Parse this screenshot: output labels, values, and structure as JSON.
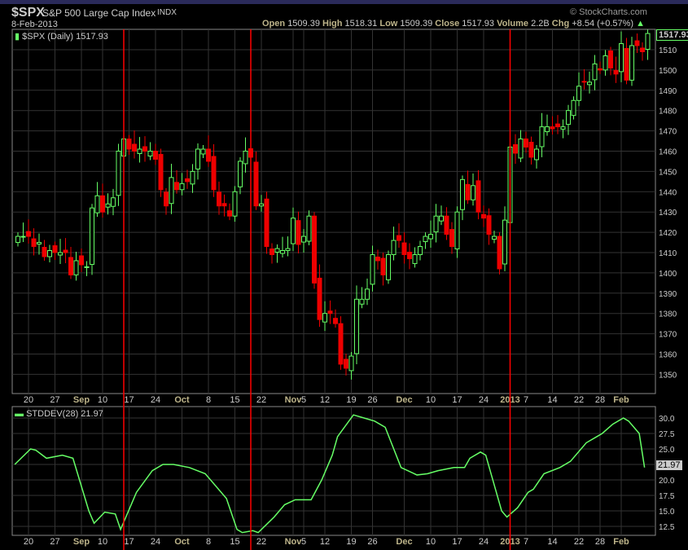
{
  "header": {
    "symbol": "$SPX",
    "name": "S&P 500 Large Cap Index",
    "exchange": "INDX",
    "date": "8-Feb-2013",
    "copyright": "© StockCharts.com",
    "open_label": "Open",
    "open": "1509.39",
    "high_label": "High",
    "high": "1518.31",
    "low_label": "Low",
    "low": "1509.39",
    "close_label": "Close",
    "close": "1517.93",
    "volume_label": "Volume",
    "volume": "2.2B",
    "chg_label": "Chg",
    "chg": "+8.54 (+0.57%)"
  },
  "colors": {
    "up": "#66ff66",
    "down": "#ee0000",
    "marker": "#ff0000",
    "grid": "#333333",
    "line": "#66ff66"
  },
  "chart_data": [
    {
      "type": "candlestick",
      "title": "$SPX (Daily) 1517.93",
      "last_value": "1517.93",
      "ylim": [
        1340,
        1520
      ],
      "yticks": [
        1350,
        1360,
        1370,
        1380,
        1390,
        1400,
        1410,
        1420,
        1430,
        1440,
        1450,
        1460,
        1470,
        1480,
        1490,
        1500,
        1510
      ],
      "close": [
        1418,
        1418,
        1418,
        1413,
        1415,
        1408,
        1411,
        1410,
        1410,
        1410,
        1399,
        1406,
        1404,
        1403,
        1432,
        1438,
        1430,
        1434,
        1437,
        1460,
        1466,
        1461,
        1460,
        1461,
        1460,
        1460,
        1456,
        1441,
        1433,
        1447,
        1441,
        1444,
        1445,
        1450,
        1461,
        1461,
        1455,
        1441,
        1433,
        1433,
        1428,
        1440,
        1455,
        1460,
        1457,
        1433,
        1434,
        1413,
        1409,
        1412,
        1411,
        1412,
        1427,
        1414,
        1418,
        1428,
        1395,
        1377,
        1380,
        1380,
        1375,
        1355,
        1353,
        1359,
        1387,
        1387,
        1392,
        1409,
        1406,
        1399,
        1409,
        1416,
        1416,
        1409,
        1407,
        1409,
        1413,
        1418,
        1419,
        1428,
        1428,
        1419,
        1413,
        1430,
        1446,
        1436,
        1443,
        1430,
        1427,
        1419,
        1418,
        1402,
        1426,
        1462,
        1459,
        1466,
        1462,
        1457,
        1461,
        1472,
        1472,
        1471,
        1472,
        1472,
        1480,
        1485,
        1492,
        1494,
        1494,
        1503,
        1500,
        1507,
        1501,
        1498,
        1513,
        1495,
        1512,
        1512,
        1509,
        1518
      ],
      "markers": [
        20,
        44,
        93
      ]
    },
    {
      "type": "line",
      "title": "STDDEV(28) 21.97",
      "last_value": "21.97",
      "ylim": [
        10.5,
        31.5
      ],
      "yticks": [
        "12.5",
        "15.0",
        "17.5",
        "20.0",
        "22.5",
        "25.0",
        "27.5",
        "30.0"
      ],
      "points": [
        [
          0,
          22.5
        ],
        [
          3,
          25
        ],
        [
          4,
          24.8
        ],
        [
          6,
          23.5
        ],
        [
          9,
          24
        ],
        [
          11,
          23.5
        ],
        [
          14,
          15
        ],
        [
          15,
          13
        ],
        [
          17,
          14.8
        ],
        [
          19,
          14.5
        ],
        [
          20,
          12
        ],
        [
          22,
          16
        ],
        [
          23,
          18
        ],
        [
          26,
          21.5
        ],
        [
          28,
          22.5
        ],
        [
          30,
          22.5
        ],
        [
          33,
          22
        ],
        [
          36,
          21
        ],
        [
          40,
          17
        ],
        [
          42,
          12
        ],
        [
          43,
          11.5
        ],
        [
          45,
          11.8
        ],
        [
          46,
          11.5
        ],
        [
          49,
          14
        ],
        [
          51,
          16
        ],
        [
          53,
          16.8
        ],
        [
          56,
          16.8
        ],
        [
          58,
          20
        ],
        [
          60,
          24
        ],
        [
          61,
          27
        ],
        [
          64,
          30.5
        ],
        [
          66,
          30
        ],
        [
          68,
          29.5
        ],
        [
          70,
          28.5
        ],
        [
          73,
          22
        ],
        [
          76,
          20.8
        ],
        [
          78,
          21
        ],
        [
          80,
          21.5
        ],
        [
          83,
          22
        ],
        [
          85,
          22
        ],
        [
          86,
          23.5
        ],
        [
          88,
          24.5
        ],
        [
          89,
          24
        ],
        [
          90,
          21
        ],
        [
          92,
          15
        ],
        [
          93,
          14
        ],
        [
          95,
          15.5
        ],
        [
          97,
          18
        ],
        [
          98,
          18.5
        ],
        [
          100,
          21
        ],
        [
          103,
          22
        ],
        [
          105,
          23
        ],
        [
          108,
          26
        ],
        [
          110,
          27
        ],
        [
          111,
          27.5
        ],
        [
          113,
          29
        ],
        [
          115,
          30
        ],
        [
          116,
          29.5
        ],
        [
          118,
          27.5
        ],
        [
          119,
          22
        ]
      ]
    }
  ],
  "xticks": [
    {
      "l": "20",
      "i": 2
    },
    {
      "l": "27",
      "i": 7
    },
    {
      "l": "Sep",
      "i": 12,
      "b": 1
    },
    {
      "l": "10",
      "i": 16
    },
    {
      "l": "17",
      "i": 21
    },
    {
      "l": "24",
      "i": 26
    },
    {
      "l": "Oct",
      "i": 31,
      "b": 1
    },
    {
      "l": "8",
      "i": 36
    },
    {
      "l": "15",
      "i": 41
    },
    {
      "l": "22",
      "i": 46
    },
    {
      "l": "Nov",
      "i": 52,
      "b": 1
    },
    {
      "l": "5",
      "i": 54
    },
    {
      "l": "12",
      "i": 58
    },
    {
      "l": "19",
      "i": 63
    },
    {
      "l": "26",
      "i": 67
    },
    {
      "l": "Dec",
      "i": 73,
      "b": 1
    },
    {
      "l": "10",
      "i": 78
    },
    {
      "l": "17",
      "i": 83
    },
    {
      "l": "24",
      "i": 88
    },
    {
      "l": "2013",
      "i": 93,
      "b": 1
    },
    {
      "l": "7",
      "i": 96
    },
    {
      "l": "14",
      "i": 101
    },
    {
      "l": "22",
      "i": 106
    },
    {
      "l": "28",
      "i": 110
    },
    {
      "l": "Feb",
      "i": 114,
      "b": 1
    }
  ]
}
